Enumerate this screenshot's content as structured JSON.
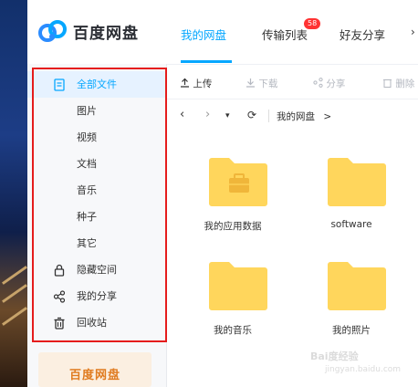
{
  "app": {
    "logo_text": "百度网盘",
    "nav": [
      {
        "label": "我的网盘",
        "active": true
      },
      {
        "label": "传输列表",
        "badge": "58"
      },
      {
        "label": "好友分享"
      }
    ]
  },
  "sidebar": {
    "items": [
      {
        "label": "全部文件",
        "icon": "document-icon",
        "active": true
      },
      {
        "label": "图片"
      },
      {
        "label": "视频"
      },
      {
        "label": "文档"
      },
      {
        "label": "音乐"
      },
      {
        "label": "种子"
      },
      {
        "label": "其它"
      },
      {
        "label": "隐藏空间",
        "icon": "lock-icon"
      },
      {
        "label": "我的分享",
        "icon": "share-icon"
      },
      {
        "label": "回收站",
        "icon": "trash-icon"
      }
    ],
    "promo": "百度网盘"
  },
  "toolbar": {
    "upload": "上传",
    "download": "下载",
    "share": "分享",
    "delete": "删除"
  },
  "path": {
    "current": "我的网盘",
    "separator": ">"
  },
  "files": [
    {
      "name": "我的应用数据",
      "type": "folder",
      "icon": "briefcase-folder-icon"
    },
    {
      "name": "software",
      "type": "folder"
    },
    {
      "name": "我的音乐",
      "type": "folder"
    },
    {
      "name": "我的照片",
      "type": "folder"
    }
  ],
  "watermark": {
    "text": "Bai度经验",
    "sub": "jingyan.baidu.com"
  },
  "colors": {
    "accent": "#06a7ff",
    "folder": "#ffd65c",
    "highlight_box": "#e51c1c"
  }
}
